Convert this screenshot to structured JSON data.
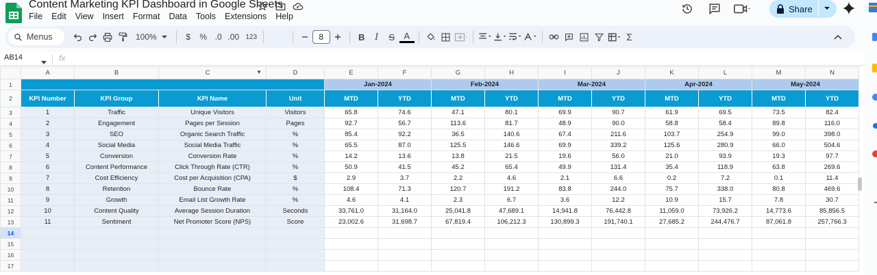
{
  "document": {
    "title": "Content Marketing KPI Dashboard in Google Sheets"
  },
  "menu": [
    "File",
    "Edit",
    "View",
    "Insert",
    "Format",
    "Data",
    "Tools",
    "Extensions",
    "Help"
  ],
  "share_label": "Share",
  "toolbar": {
    "menus_label": "Menus",
    "zoom": "100%",
    "currency": "$",
    "percent": "%",
    "decrease_decimal": ".0",
    "increase_decimal": ".00",
    "number_format": "123",
    "font_size": "8"
  },
  "formula_bar": {
    "name_box": "AB14",
    "fx_label": "fx"
  },
  "columns": [
    "A",
    "B",
    "C",
    "D",
    "E",
    "F",
    "G",
    "H",
    "I",
    "J",
    "K",
    "L",
    "M",
    "N"
  ],
  "row_numbers": [
    "1",
    "2",
    "3",
    "4",
    "5",
    "6",
    "7",
    "8",
    "9",
    "10",
    "11",
    "12",
    "13",
    "14",
    "15",
    "16",
    "17"
  ],
  "months": [
    "Jan-2024",
    "Feb-2024",
    "Mar-2024",
    "Apr-2024",
    "May-2024"
  ],
  "table_headers": [
    "KPI Number",
    "KPI Group",
    "KPI Name",
    "Unit",
    "MTD",
    "YTD",
    "MTD",
    "YTD",
    "MTD",
    "YTD",
    "MTD",
    "YTD",
    "MTD",
    "YTD"
  ],
  "rows": [
    [
      "1",
      "Traffic",
      "Unique Visitors",
      "Visitors",
      "65.8",
      "74.6",
      "47.1",
      "80.1",
      "69.9",
      "90.7",
      "61.9",
      "69.5",
      "73.5",
      "82.4"
    ],
    [
      "2",
      "Engagement",
      "Pages per Session",
      "Pages",
      "92.7",
      "56.7",
      "113.6",
      "81.7",
      "48.9",
      "90.0",
      "58.8",
      "58.4",
      "89.8",
      "116.0"
    ],
    [
      "3",
      "SEO",
      "Organic Search Traffic",
      "%",
      "85.4",
      "92.2",
      "36.5",
      "140.6",
      "67.4",
      "211.6",
      "103.7",
      "254.9",
      "99.0",
      "398.0"
    ],
    [
      "4",
      "Social Media",
      "Social Media Traffic",
      "%",
      "65.5",
      "87.0",
      "125.5",
      "146.6",
      "69.9",
      "339.2",
      "125.6",
      "280.9",
      "66.0",
      "504.6"
    ],
    [
      "5",
      "Conversion",
      "Conversion Rate",
      "%",
      "14.2",
      "13.6",
      "13.8",
      "21.5",
      "19.6",
      "56.0",
      "21.0",
      "93.9",
      "19.3",
      "97.7"
    ],
    [
      "6",
      "Content Performance",
      "Click Through Rate (CTR)",
      "%",
      "50.9",
      "41.5",
      "45.2",
      "65.4",
      "49.9",
      "131.4",
      "35.4",
      "118.9",
      "63.8",
      "269.6"
    ],
    [
      "7",
      "Cost Efficiency",
      "Cost per Acquisition (CPA)",
      "$",
      "2.9",
      "3.7",
      "2.2",
      "4.6",
      "2.1",
      "6.6",
      "0.2",
      "7.2",
      "0.1",
      "11.4"
    ],
    [
      "8",
      "Retention",
      "Bounce Rate",
      "%",
      "108.4",
      "71.3",
      "120.7",
      "191.2",
      "83.8",
      "244.0",
      "75.7",
      "338.0",
      "80.8",
      "469.6"
    ],
    [
      "9",
      "Growth",
      "Email List Growth Rate",
      "%",
      "4.6",
      "4.1",
      "2.3",
      "6.7",
      "3.6",
      "12.2",
      "10.9",
      "15.7",
      "7.8",
      "30.7"
    ],
    [
      "10",
      "Content Quality",
      "Average Session Duration",
      "Seconds",
      "33,761.0",
      "31,164.0",
      "25,041.8",
      "47,689.1",
      "14,941.8",
      "76,442.8",
      "11,059.0",
      "73,926.2",
      "14,773.6",
      "85,856.5"
    ],
    [
      "11",
      "Sentiment",
      "Net Promoter Score (NPS)",
      "Score",
      "23,002.6",
      "31,698.7",
      "67,819.4",
      "106,212.3",
      "130,899.3",
      "191,740.1",
      "27,685.2",
      "244,476.7",
      "87,061.8",
      "257,766.3"
    ]
  ],
  "colors": {
    "header_blue": "#0a9bd3",
    "month_band": "#aecbef",
    "label_fill": "#e8eef8",
    "share_bg": "#c2e7ff"
  }
}
